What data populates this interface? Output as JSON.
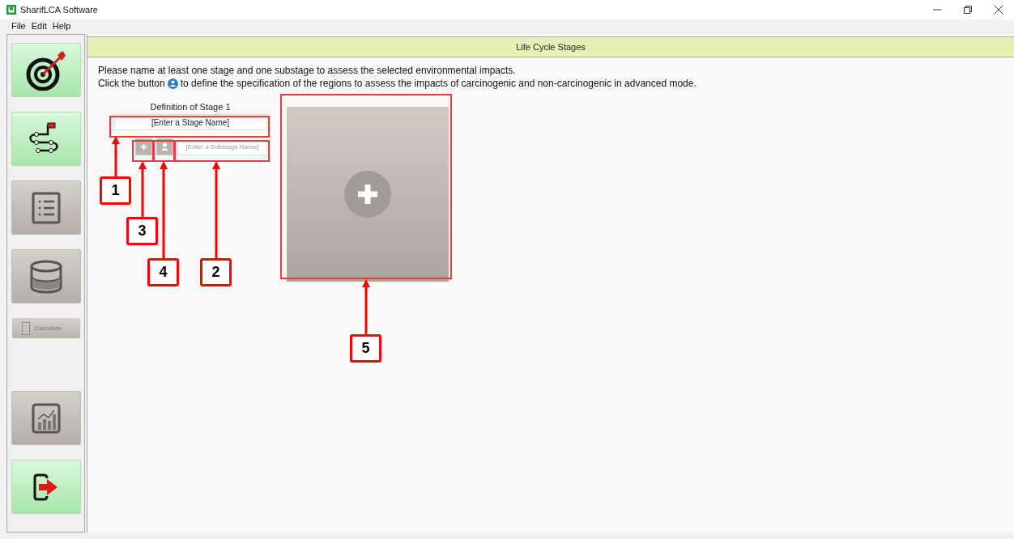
{
  "window": {
    "title": "SharifLCA Software"
  },
  "menu": [
    "File",
    "Edit",
    "Help"
  ],
  "sidebar": [
    {
      "kind": "target",
      "enabled": true
    },
    {
      "kind": "route",
      "enabled": true
    },
    {
      "kind": "list",
      "enabled": false
    },
    {
      "kind": "database",
      "enabled": false
    },
    {
      "kind": "calculate",
      "enabled": false,
      "label": "Calculate"
    },
    {
      "kind": "chart",
      "enabled": false
    },
    {
      "kind": "exit",
      "enabled": true
    }
  ],
  "header": {
    "title": "Life Cycle Stages"
  },
  "instructions": {
    "line_1": "Please name at least one stage and one substage to assess the selected environmental impacts.",
    "line_2_before": "Click the button",
    "line_2_after": "to define the specification of the regions to assess the impacts of carcinogenic and non-carcinogenic in advanced mode."
  },
  "stage": {
    "title": "Definition of Stage 1",
    "name_placeholder": "[Enter a Stage Name]",
    "substage_placeholder": "[Enter a Substage Name]"
  },
  "callouts": [
    "1",
    "3",
    "4",
    "2",
    "5"
  ]
}
